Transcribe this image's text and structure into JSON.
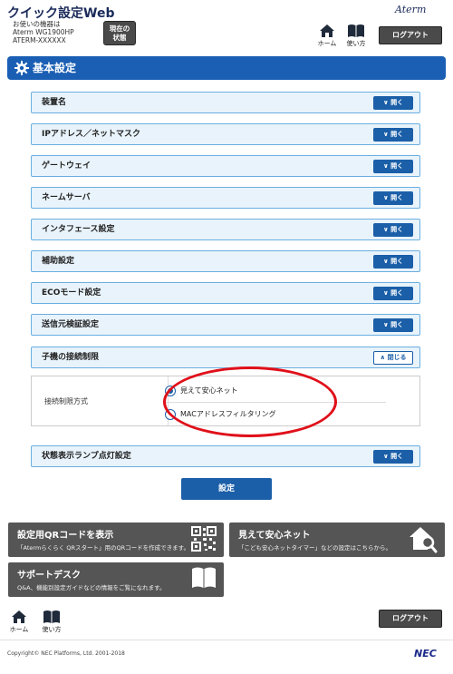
{
  "header": {
    "title": "クイック設定Web",
    "device_line1": "お使いの機器は",
    "device_line2": "Aterm WG1900HP",
    "device_line3": "ATERM-XXXXXX",
    "status_button_line1": "現在の",
    "status_button_line2": "状態",
    "brand": "Aterm",
    "home_label": "ホーム",
    "howto_label": "使い方",
    "logout_label": "ログアウト"
  },
  "section": {
    "title": "基本設定"
  },
  "rows": [
    {
      "label": "装置名",
      "button": "開く"
    },
    {
      "label": "IPアドレス／ネットマスク",
      "button": "開く"
    },
    {
      "label": "ゲートウェイ",
      "button": "開く"
    },
    {
      "label": "ネームサーバ",
      "button": "開く"
    },
    {
      "label": "インタフェース設定",
      "button": "開く"
    },
    {
      "label": "補助設定",
      "button": "開く"
    },
    {
      "label": "ECOモード設定",
      "button": "開く"
    },
    {
      "label": "送信元検証設定",
      "button": "開く"
    },
    {
      "label": "子機の接続制限",
      "button": "閉じる"
    },
    {
      "label": "状態表示ランプ点灯設定",
      "button": "開く"
    }
  ],
  "connection_limit": {
    "label": "接続制限方式",
    "options": [
      {
        "label": "見えて安心ネット",
        "checked": true
      },
      {
        "label": "MACアドレスフィルタリング",
        "checked": false
      }
    ],
    "highlight_color": "#e0101a"
  },
  "set_button": "設定",
  "tiles": {
    "qr": {
      "title": "設定用QRコードを表示",
      "desc": "「Atermらくらく QRスタート」用のQRコードを作成できます。"
    },
    "mieru": {
      "title": "見えて安心ネット",
      "desc": "「こども安心ネットタイマー」などの設定はこちらから。"
    },
    "support": {
      "title": "サポートデスク",
      "desc": "Q&A、機能別設定ガイドなどの情報をご覧になれます。"
    }
  },
  "footer": {
    "home_label": "ホーム",
    "howto_label": "使い方",
    "logout_label": "ログアウト",
    "copyright": "Copyright© NEC Platforms, Ltd. 2001-2018",
    "logo": "NEC"
  },
  "colors": {
    "accent": "#1a5fb4",
    "row_bg": "#e8f3fb",
    "row_border": "#6aaee0",
    "tile_bg": "#555555"
  }
}
